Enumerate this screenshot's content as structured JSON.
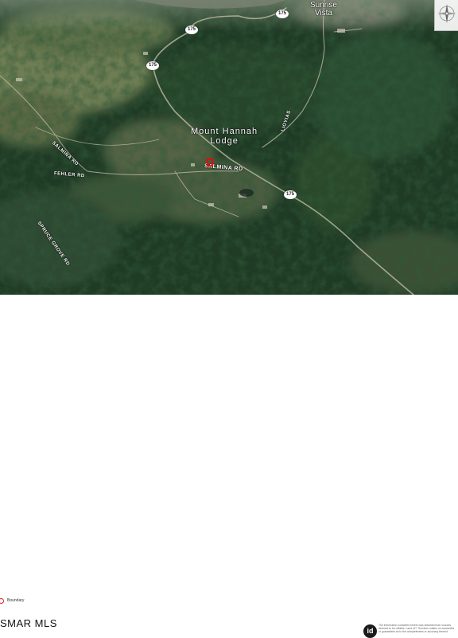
{
  "map": {
    "places": {
      "sunrise_vista": [
        "Sunrise",
        "Vista"
      ],
      "mount_hannah_lodge": [
        "Mount Hannah",
        "Lodge"
      ]
    },
    "highway": {
      "shield_text": "175"
    },
    "roads": {
      "salmina_rd": "SALMINA RD",
      "salmina_rd_west": "SALMINA RD",
      "fehler_rd": "FEHLER RD",
      "spruce_grove_rd": "SPRUCE GROVE RD",
      "hill_road_east": "LIOYIAS"
    },
    "boundary_color": "#ff0000"
  },
  "legend": {
    "label": "Boundary",
    "swatch_color": "#e02020"
  },
  "footer": {
    "logo_text": "SMAR MLS",
    "badge_text": "id",
    "disclaimer": "The information contained herein was obtained from sources deemed to be reliable. Land id™ Services makes no warranties or guarantees as to the completeness or accuracy thereof."
  }
}
